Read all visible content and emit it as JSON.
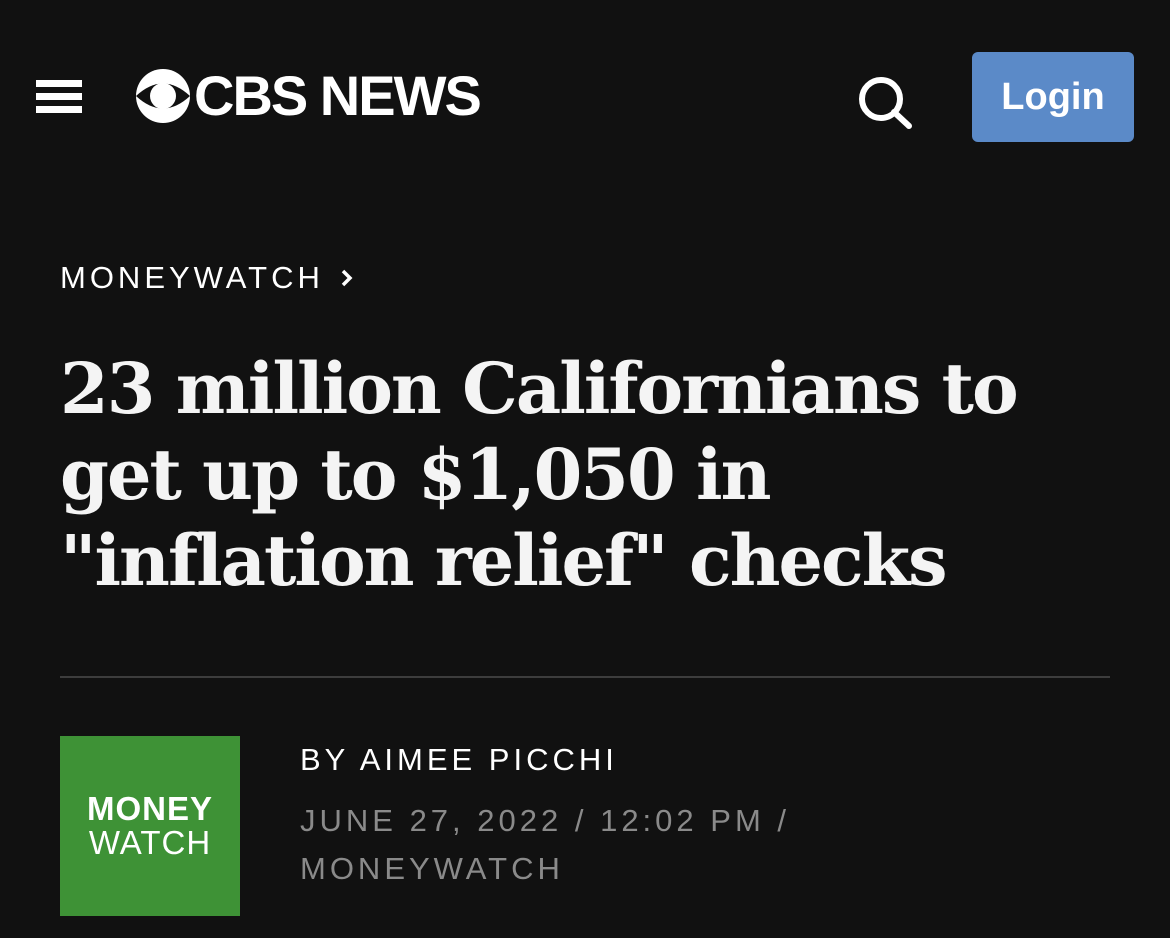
{
  "header": {
    "logo_text": "CBS NEWS",
    "login_label": "Login",
    "icons": {
      "menu": "hamburger-menu-icon",
      "search": "search-icon",
      "logo_mark": "cbs-eye-icon"
    },
    "colors": {
      "login_bg": "#5b8ac8"
    }
  },
  "article": {
    "breadcrumb": "MONEYWATCH",
    "headline": "23 million Californians to get up to $1,050 in \"inflation relief\" checks",
    "byline_prefix": "BY ",
    "author": "AIMEE PICCHI",
    "date": "JUNE 27, 2022 / 12:02 PM /",
    "category": "MONEYWATCH",
    "thumbnail": {
      "line1": "MONEY",
      "line2": "WATCH",
      "bg_color": "#3e9236"
    }
  },
  "colors": {
    "page_bg": "#111111",
    "meta_text": "#8a8a8a",
    "divider": "#3d3d3d"
  }
}
